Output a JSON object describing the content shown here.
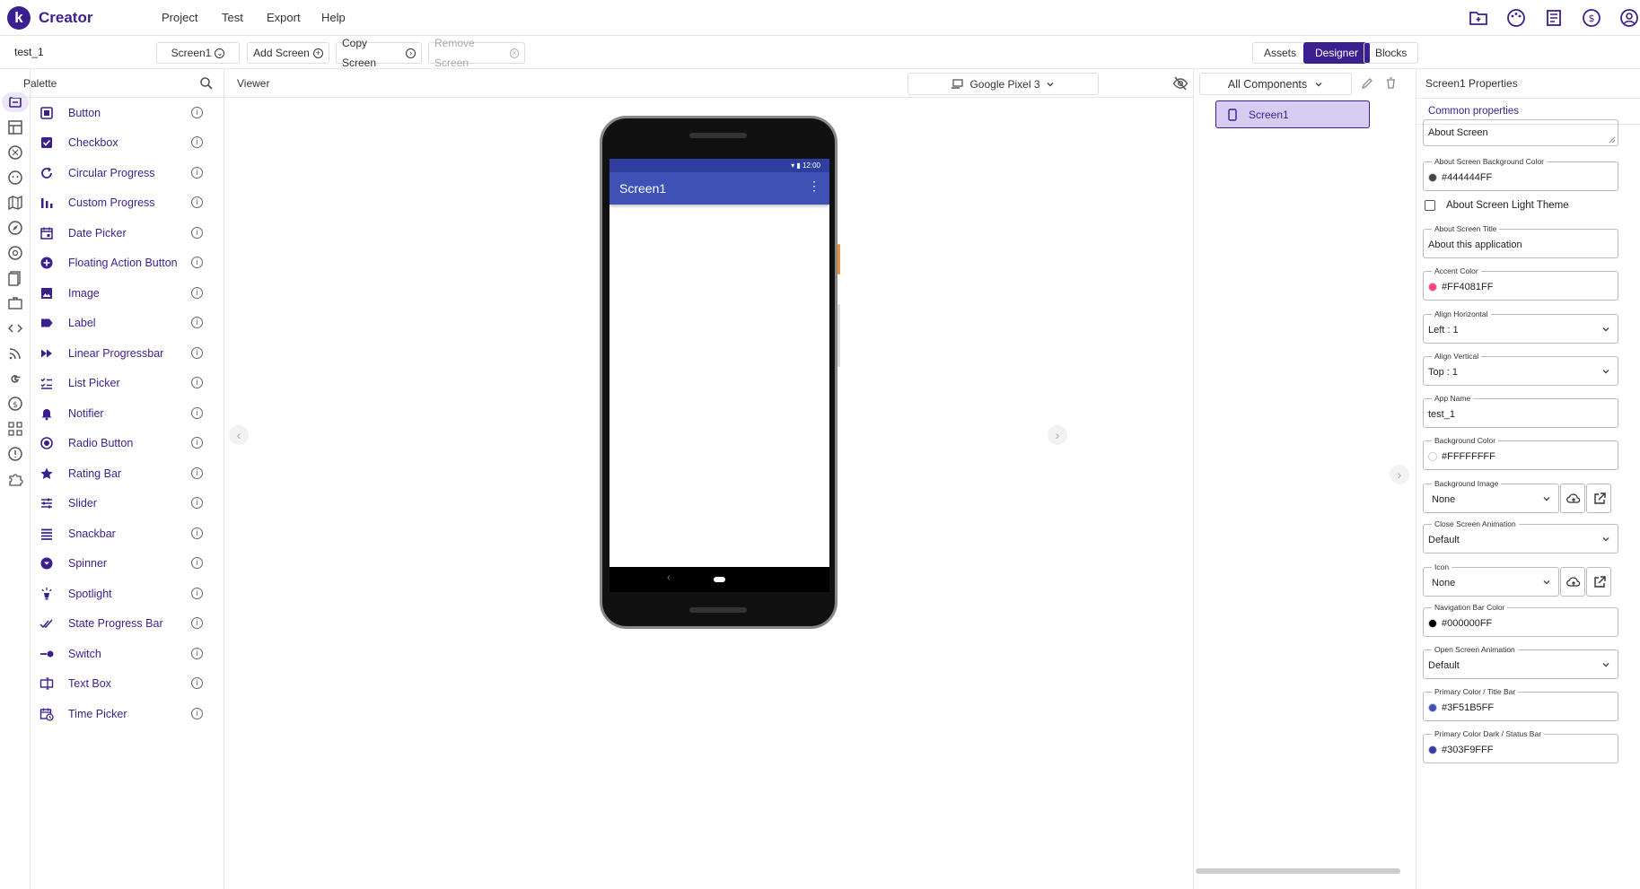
{
  "app": {
    "brand": "Creator",
    "logo_letter": "k"
  },
  "menu": [
    "Project",
    "Test",
    "Export",
    "Help"
  ],
  "toolbar": {
    "project_name": "test_1",
    "screen_select": "Screen1",
    "add_screen": "Add Screen",
    "copy_screen": "Copy Screen",
    "remove_screen": "Remove Screen",
    "assets": "Assets",
    "designer": "Designer",
    "blocks": "Blocks"
  },
  "palette": {
    "title": "Palette",
    "items": [
      {
        "label": "Button"
      },
      {
        "label": "Checkbox"
      },
      {
        "label": "Circular Progress"
      },
      {
        "label": "Custom Progress"
      },
      {
        "label": "Date Picker"
      },
      {
        "label": "Floating Action Button"
      },
      {
        "label": "Image"
      },
      {
        "label": "Label"
      },
      {
        "label": "Linear Progressbar"
      },
      {
        "label": "List Picker"
      },
      {
        "label": "Notifier"
      },
      {
        "label": "Radio Button"
      },
      {
        "label": "Rating Bar"
      },
      {
        "label": "Slider"
      },
      {
        "label": "Snackbar"
      },
      {
        "label": "Spinner"
      },
      {
        "label": "Spotlight"
      },
      {
        "label": "State Progress Bar"
      },
      {
        "label": "Switch"
      },
      {
        "label": "Text Box"
      },
      {
        "label": "Time Picker"
      }
    ]
  },
  "viewer": {
    "title": "Viewer",
    "device": "Google Pixel 3",
    "phone": {
      "time": "12:00",
      "screen_title": "Screen1"
    }
  },
  "components": {
    "filter": "All Components",
    "tree": [
      {
        "label": "Screen1"
      }
    ]
  },
  "properties": {
    "title": "Screen1 Properties",
    "section": "Common properties",
    "about_screen": "About Screen",
    "about_bg_color": {
      "label": "About Screen Background Color",
      "value": "#444444FF",
      "color": "#444444"
    },
    "light_theme": {
      "label": "About Screen Light Theme"
    },
    "about_title": {
      "label": "About Screen Title",
      "value": "About this application"
    },
    "accent_color": {
      "label": "Accent Color",
      "value": "#FF4081FF",
      "color": "#FF4081"
    },
    "align_h": {
      "label": "Align Horizontal",
      "value": "Left : 1"
    },
    "align_v": {
      "label": "Align Vertical",
      "value": "Top : 1"
    },
    "app_name": {
      "label": "App Name",
      "value": "test_1"
    },
    "bg_color": {
      "label": "Background Color",
      "value": "#FFFFFFFF",
      "color": "#FFFFFF"
    },
    "bg_image": {
      "label": "Background Image",
      "value": "None"
    },
    "close_anim": {
      "label": "Close Screen Animation",
      "value": "Default"
    },
    "icon": {
      "label": "Icon",
      "value": "None"
    },
    "nav_color": {
      "label": "Navigation Bar Color",
      "value": "#000000FF",
      "color": "#000000"
    },
    "open_anim": {
      "label": "Open Screen Animation",
      "value": "Default"
    },
    "primary": {
      "label": "Primary Color / Title Bar",
      "value": "#3F51B5FF",
      "color": "#3F51B5"
    },
    "primary_dark": {
      "label": "Primary Color Dark / Status Bar",
      "value": "#303F9FFF",
      "color": "#303F9F"
    }
  },
  "colors": {
    "accent": "#3c1f8f"
  }
}
